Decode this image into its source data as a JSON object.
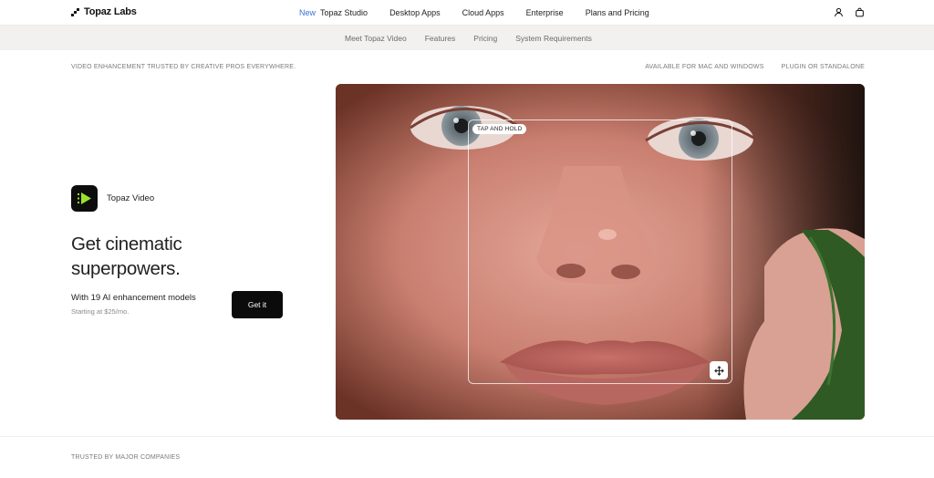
{
  "brand": {
    "name": "Topaz Labs"
  },
  "topnav": {
    "new_badge": "New",
    "items": [
      "Topaz Studio",
      "Desktop Apps",
      "Cloud Apps",
      "Enterprise",
      "Plans and Pricing"
    ],
    "icons": [
      "user-icon",
      "bag-icon"
    ]
  },
  "subnav": {
    "items": [
      "Meet Topaz Video",
      "Features",
      "Pricing",
      "System Requirements"
    ]
  },
  "infobar": {
    "left": "VIDEO ENHANCEMENT TRUSTED BY CREATIVE PROS EVERYWHERE.",
    "right": [
      "AVAILABLE FOR MAC AND WINDOWS",
      "PLUGIN OR STANDALONE"
    ]
  },
  "hero": {
    "app_name": "Topaz Video",
    "title": "Get cinematic superpowers.",
    "models": "With 19 AI enhancement models",
    "price": "Starting at $25/mo.",
    "cta": "Get it",
    "app_icon_color": "#9be22d"
  },
  "comparison": {
    "tap_label": "TAP AND HOLD",
    "handle_icon": "move-icon"
  },
  "footer": {
    "trusted": "TRUSTED BY MAJOR COMPANIES"
  }
}
